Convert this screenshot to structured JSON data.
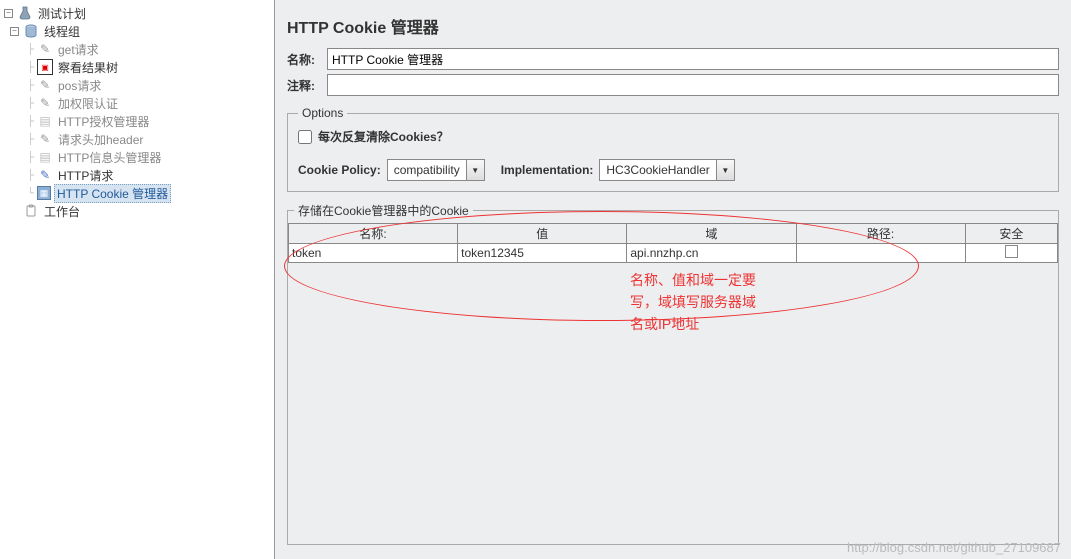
{
  "tree": {
    "root": "测试计划",
    "thread_group": "线程组",
    "items": [
      "get请求",
      "察看结果树",
      "pos请求",
      "加权限认证",
      "HTTP授权管理器",
      "请求头加header",
      "HTTP信息头管理器",
      "HTTP请求",
      "HTTP Cookie 管理器"
    ],
    "workbench": "工作台"
  },
  "panel": {
    "title": "HTTP Cookie 管理器",
    "name_label": "名称:",
    "name_value": "HTTP Cookie 管理器",
    "comment_label": "注释:",
    "comment_value": ""
  },
  "options": {
    "legend": "Options",
    "clear_label": "每次反复清除Cookies？",
    "policy_label": "Cookie Policy:",
    "policy_value": "compatibility",
    "impl_label": "Implementation:",
    "impl_value": "HC3CookieHandler"
  },
  "storage": {
    "legend": "存储在Cookie管理器中的Cookie",
    "headers": {
      "name": "名称:",
      "value": "值",
      "domain": "域",
      "path": "路径:",
      "safe": "安全"
    },
    "row": {
      "name": "token",
      "value": "token12345",
      "domain": "api.nnzhp.cn",
      "path": ""
    }
  },
  "annotation": {
    "line1": "名称、值和域一定要",
    "line2": "写，域填写服务器域",
    "line3": "名或IP地址"
  },
  "watermark": "http://blog.csdn.net/github_27109687"
}
